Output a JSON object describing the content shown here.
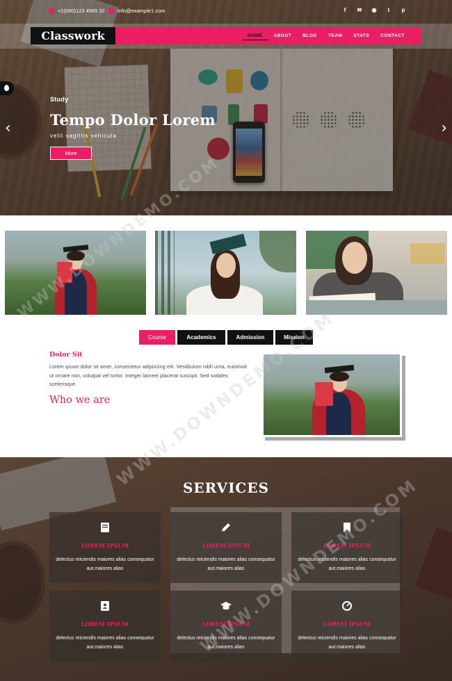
{
  "topbar": {
    "phone": "+1(000)123 4565 32",
    "email": "info@example1.com",
    "social": [
      "f",
      "✉",
      "rss",
      "t",
      "p"
    ]
  },
  "nav": {
    "brand": "Classwork",
    "links": [
      "HOME",
      "ABOUT",
      "BLOG",
      "TEAM",
      "STATS",
      "CONTACT"
    ],
    "active": "HOME"
  },
  "hero": {
    "kicker": "Study",
    "title": "Tempo Dolor Lorem",
    "subtitle": "velit sagittis vehicula",
    "button": "More",
    "arrow_left": "‹",
    "arrow_right": "›"
  },
  "tabs": [
    "Course",
    "Academics",
    "Admission",
    "Mission"
  ],
  "about": {
    "heading": "Dolor Sit",
    "paragraph": "Lorem ipsum dolor sit amet, consectetur adipiscing elit. Vestibulum nibh urna, euismod ut ornare non, volutpat vel tortor. Integer laoreet placerat suscipit. Sed sodales scelerisque",
    "who": "Who we are"
  },
  "services": {
    "title": "SERVICES",
    "cards": [
      {
        "icon": "book-icon",
        "title": "LOREM IPSUM",
        "desc": "delectus reiciendis maiores alias consequatur aut.maiores alias"
      },
      {
        "icon": "pencil-icon",
        "title": "LOREM IPSUM",
        "desc": "delectus reiciendis maiores alias consequatur aut.maiores alias"
      },
      {
        "icon": "bookmark-icon",
        "title": "LOREM IPSUM",
        "desc": "delectus reiciendis maiores alias consequatur aut.maiores alias"
      },
      {
        "icon": "address-book-icon",
        "title": "LOREM IPSUM",
        "desc": "delectus reiciendis maiores alias consequatur aut.maiores alias"
      },
      {
        "icon": "graduation-cap-icon",
        "title": "LOREM IPSUM",
        "desc": "delectus reiciendis maiores alias consequatur aut.maiores alias"
      },
      {
        "icon": "dashboard-icon",
        "title": "LOREM IPSUM",
        "desc": "delectus reiciendis maiores alias consequatur aut.maiores alias"
      }
    ]
  },
  "watermark": "WWW.DOWNDEMO.COM",
  "colors": {
    "accent": "#e91e63",
    "dark": "#111111"
  }
}
